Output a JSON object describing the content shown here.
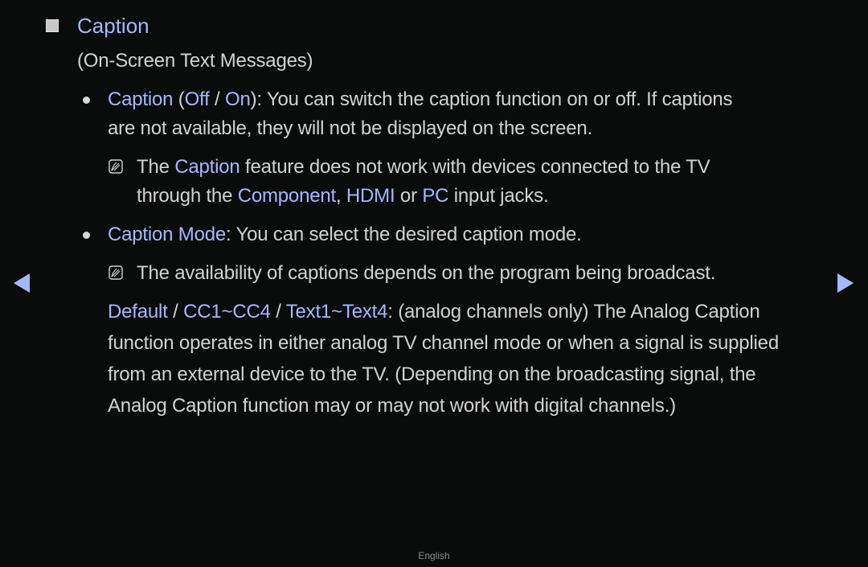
{
  "section": {
    "title": "Caption",
    "subtitle": "(On-Screen Text Messages)"
  },
  "items": [
    {
      "label": "Caption",
      "open_paren": " (",
      "opt1": "Off",
      "sep": " / ",
      "opt2": "On",
      "close": "): ",
      "desc_line1": "You can switch the caption function on or off. If captions",
      "desc_line2": "are not available, they will not be displayed on the screen.",
      "note": {
        "pre": "The ",
        "term": "Caption",
        "line1_post": " feature does not work with devices connected to the TV",
        "line2_pre": "through the ",
        "term2": "Component",
        "comma": ", ",
        "term3": "HDMI",
        "or": " or ",
        "term4": "PC",
        "line2_post": " input jacks."
      }
    },
    {
      "label": "Caption Mode",
      "colon": ": ",
      "desc": "You can select the desired caption mode.",
      "note": "The availability of captions depends on the program being broadcast.",
      "modes": {
        "m1": "Default",
        "sep": " / ",
        "m2": "CC1",
        "tilde": "~",
        "m3": "CC4",
        "m4": "Text1",
        "m5": "Text4",
        "colon": ": ",
        "line1_post": "(analog channels only) The Analog Caption",
        "line2": "function operates in either analog TV channel mode or when a signal is supplied",
        "line3": "from an external device to the TV. (Depending on the broadcasting signal, the",
        "line4": "Analog Caption function may or may not work with digital channels.)"
      }
    }
  ],
  "navigation": {
    "prev_icon": "triangle-left",
    "next_icon": "triangle-right"
  },
  "footer": {
    "language": "English"
  },
  "colors": {
    "background": "#0a0c0c",
    "text": "#d2d2d2",
    "highlight": "#a3b8ff"
  }
}
